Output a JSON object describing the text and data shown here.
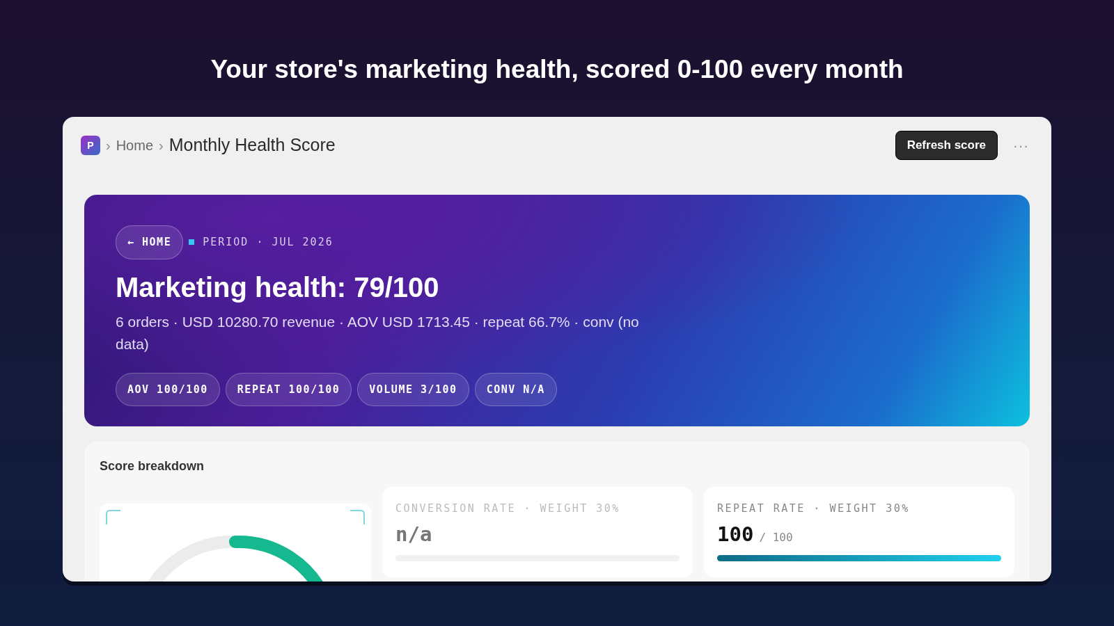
{
  "headline": "Your store's marketing health, scored 0-100 every month",
  "breadcrumb": {
    "app_letter": "P",
    "items": [
      {
        "separator": "›",
        "label": "Home",
        "current": false
      },
      {
        "separator": "›",
        "label": "Monthly Health Score",
        "current": true
      }
    ]
  },
  "actions": {
    "refresh": "Refresh score",
    "more": "···"
  },
  "hero": {
    "back": "← HOME",
    "period": "PERIOD · JUL 2026",
    "title": "Marketing health: 79/100",
    "summary": "6 orders · USD 10280.70 revenue · AOV USD 1713.45 · repeat 66.7% · conv (no data)",
    "chips": [
      "AOV 100/100",
      "REPEAT 100/100",
      "VOLUME 3/100",
      "CONV N/A"
    ]
  },
  "breakdown": {
    "title": "Score breakdown",
    "metrics": [
      {
        "label": "CONVERSION RATE · WEIGHT 30%",
        "value": "n/a",
        "muted": true
      },
      {
        "label": "REPEAT RATE · WEIGHT 30%",
        "value": "100",
        "max": "/ 100",
        "muted": false,
        "level": 1
      }
    ]
  }
}
